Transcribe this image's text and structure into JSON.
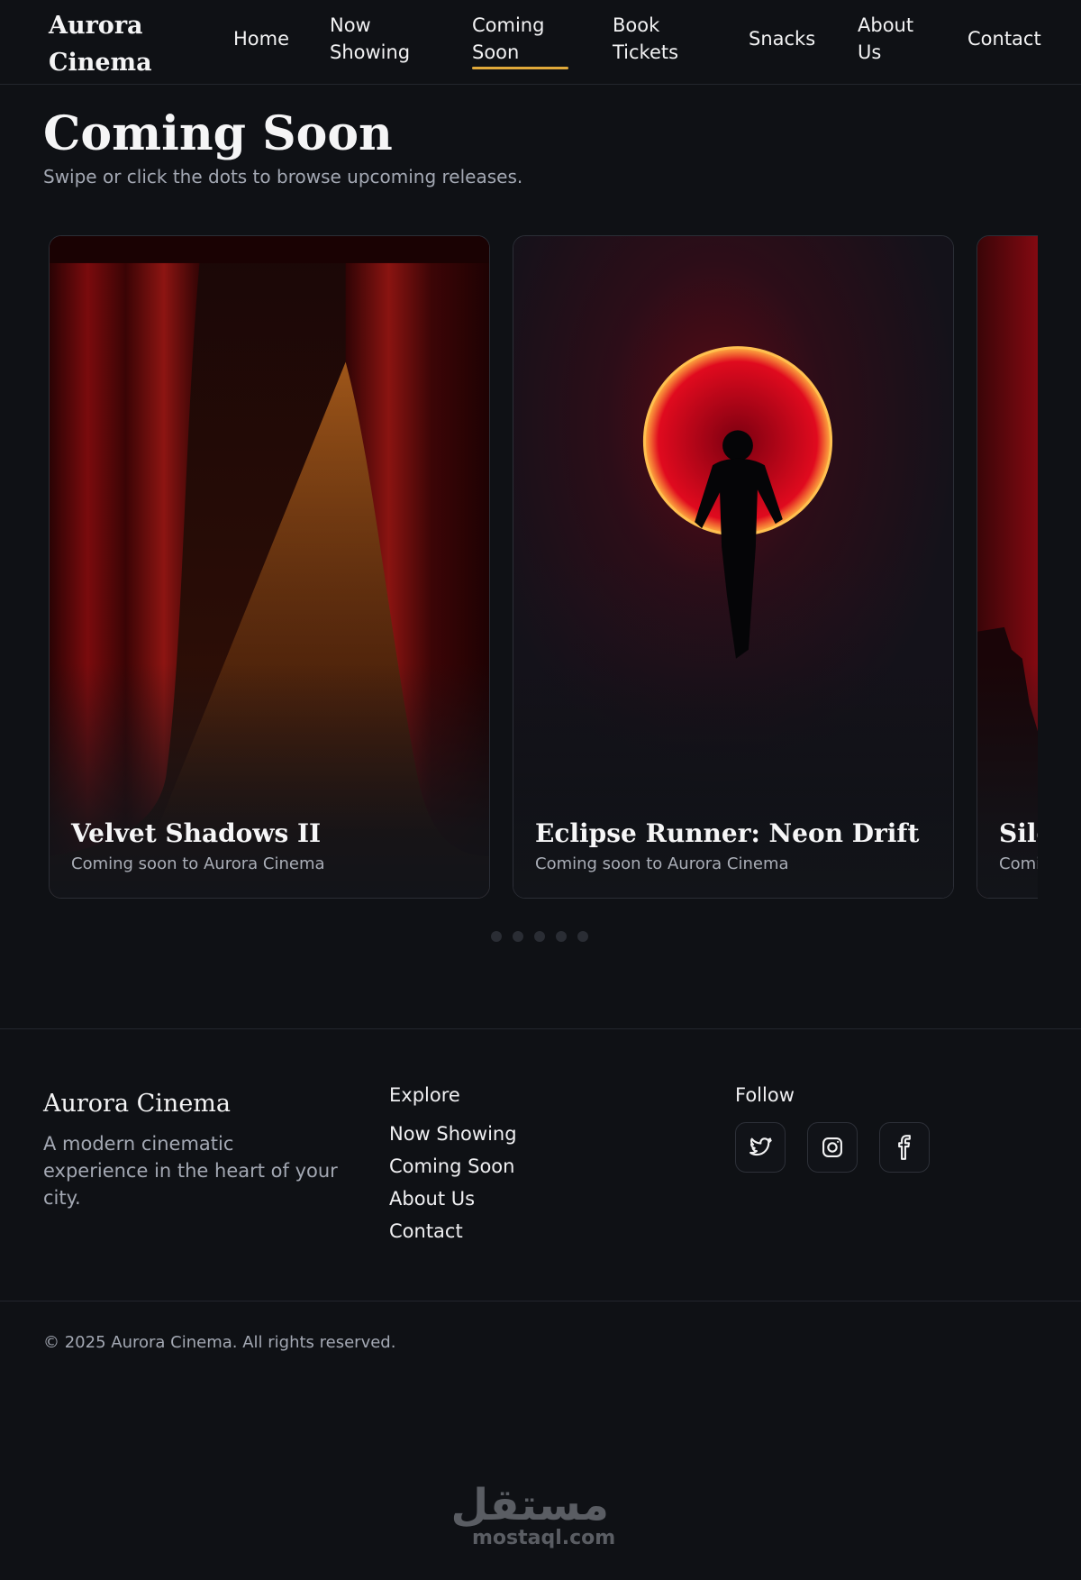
{
  "header": {
    "brand": "Aurora Cinema",
    "nav": [
      {
        "label": "Home",
        "active": false
      },
      {
        "label": "Now Showing",
        "active": false
      },
      {
        "label": "Coming Soon",
        "active": true
      },
      {
        "label": "Book Tickets",
        "active": false
      },
      {
        "label": "Snacks",
        "active": false
      },
      {
        "label": "About Us",
        "active": false
      },
      {
        "label": "Contact",
        "active": false
      }
    ]
  },
  "main": {
    "title": "Coming Soon",
    "subtitle": "Swipe or click the dots to browse upcoming releases.",
    "carousel": {
      "cards": [
        {
          "title": "Velvet Shadows II",
          "subtitle": "Coming soon to Aurora Cinema",
          "art": "theater-curtain-spotlight"
        },
        {
          "title": "Eclipse Runner: Neon Drift",
          "subtitle": "Coming soon to Aurora Cinema",
          "art": "runner-red-eclipse"
        },
        {
          "title": "Sile",
          "subtitle": "Comi",
          "art": "red-ruins"
        }
      ],
      "dot_count": 5,
      "active_dot": 0
    }
  },
  "footer": {
    "brand": "Aurora Cinema",
    "tagline": "A modern cinematic experience in the heart of your city.",
    "explore_heading": "Explore",
    "explore_links": [
      "Now Showing",
      "Coming Soon",
      "About Us",
      "Contact"
    ],
    "follow_heading": "Follow",
    "social": [
      "twitter-icon",
      "instagram-icon",
      "facebook-icon"
    ],
    "copyright": "© 2025 Aurora Cinema. All rights reserved."
  },
  "watermark": {
    "arabic": "مستقل",
    "latin": "mostaql.com"
  },
  "colors": {
    "background": "#0f1115",
    "accent": "#e0a93a",
    "muted_text": "#a3a8b3"
  }
}
